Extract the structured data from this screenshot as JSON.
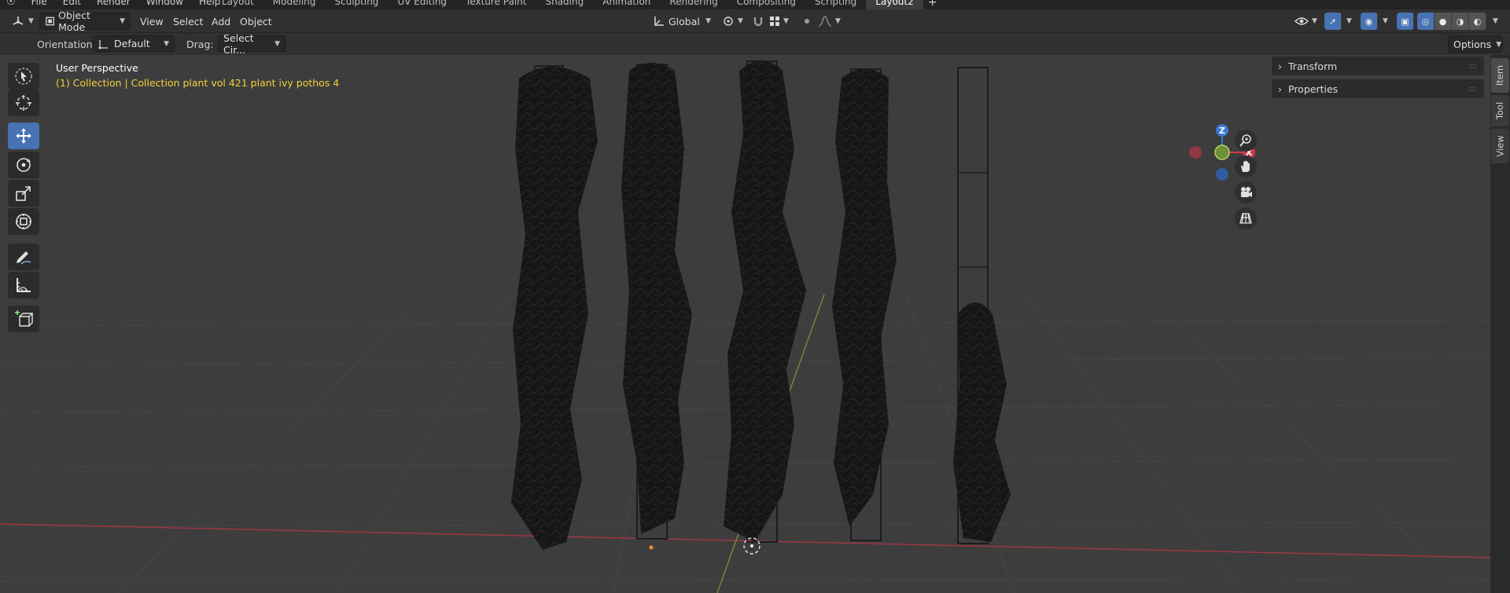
{
  "topbar": {
    "menu": [
      "File",
      "Edit",
      "Render",
      "Window",
      "Help"
    ],
    "workspaces": [
      "Layout",
      "Modeling",
      "Sculpting",
      "UV Editing",
      "Texture Paint",
      "Shading",
      "Animation",
      "Rendering",
      "Compositing",
      "Scripting",
      "Layout2"
    ],
    "active_workspace": "Layout2",
    "add_workspace": "+"
  },
  "header": {
    "mode": "Object Mode",
    "menus": [
      "View",
      "Select",
      "Add",
      "Object"
    ],
    "transform_orientation": "Global",
    "options_label": "Options"
  },
  "tool_settings": {
    "orientation_label": "Orientation:",
    "orientation_value": "Default",
    "drag_label": "Drag:",
    "drag_value": "Select Cir..."
  },
  "viewport": {
    "title": "User Perspective",
    "collection_info": "(1) Collection | Collection plant vol 421 plant ivy pothos 4",
    "gizmo": {
      "z": "Z",
      "x": "X"
    }
  },
  "toolbar": {
    "tools": [
      {
        "name": "select-box",
        "icon": "cursor-select-icon",
        "active": false
      },
      {
        "name": "cursor",
        "icon": "3d-cursor-icon",
        "active": false
      },
      {
        "name": "move",
        "icon": "move-icon",
        "active": true
      },
      {
        "name": "rotate",
        "icon": "rotate-icon",
        "active": false
      },
      {
        "name": "scale",
        "icon": "scale-icon",
        "active": false
      },
      {
        "name": "transform",
        "icon": "transform-icon",
        "active": false
      },
      {
        "name": "annotate",
        "icon": "annotate-icon",
        "active": false
      },
      {
        "name": "measure",
        "icon": "measure-icon",
        "active": false
      },
      {
        "name": "add-cube",
        "icon": "add-cube-icon",
        "active": false
      }
    ]
  },
  "sidebar": {
    "panels": [
      "Transform",
      "Properties"
    ],
    "tabs": [
      "Item",
      "Tool",
      "View"
    ],
    "active_tab": "Item"
  },
  "colors": {
    "accent": "#4772b3",
    "axis_x": "#d03b4a",
    "axis_y": "#7ea73a",
    "axis_z": "#3a78d6",
    "collection_text": "#f0d03a"
  }
}
